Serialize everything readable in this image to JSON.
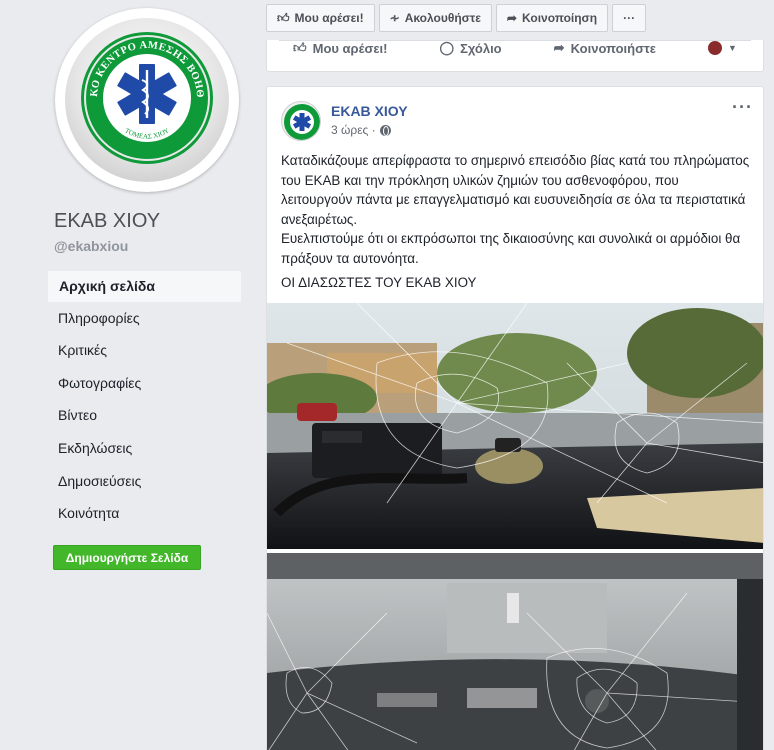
{
  "page": {
    "name": "ΕΚΑΒ ΧΙΟΥ",
    "handle": "@ekabxiou",
    "logo": {
      "ring_text_top": "ΕΘΝΙΚΟ ΚΕΝΤΡΟ ΑΜΕΣΗΣ ΒΟΗΘΕΙΑΣ",
      "ring_text_bottom": "ΤΟΜΕΑΣ ΧΙΟΥ",
      "colors": {
        "ring": "#0f9a3a",
        "star": "#1f4aa8",
        "text": "#ffffff"
      }
    }
  },
  "nav": {
    "items": [
      {
        "label": "Αρχική σελίδα",
        "active": true
      },
      {
        "label": "Πληροφορίες"
      },
      {
        "label": "Κριτικές"
      },
      {
        "label": "Φωτογραφίες"
      },
      {
        "label": "Βίντεο"
      },
      {
        "label": "Εκδηλώσεις"
      },
      {
        "label": "Δημοσιεύσεις"
      },
      {
        "label": "Κοινότητα"
      }
    ],
    "create_page_label": "Δημιουργήστε Σελίδα"
  },
  "actionbar": {
    "like": "Μου αρέσει!",
    "follow": "Ακολουθήστε",
    "share": "Κοινοποίηση",
    "more": "···"
  },
  "prev_post_actions": {
    "like": "Μου αρέσει!",
    "comment": "Σχόλιο",
    "share": "Κοινοποιήστε"
  },
  "post": {
    "author": "ΕΚΑΒ ΧΙΟΥ",
    "time": "3 ώρες ·",
    "more": "···",
    "paragraph1": "Καταδικάζουμε απερίφραστα το σημερινό επεισόδιο βίας κατά του πληρώματος του ΕΚΑΒ και την πρόκληση υλικών ζημιών του ασθενοφόρου, που λειτουργούν πάντα με επαγγελματισμό και ευσυνειδησία σε όλα τα περιστατικά ανεξαιρέτως.",
    "paragraph2": "Ευελπιστούμε ότι οι εκπρόσωποι της δικαιοσύνης και συνολικά οι αρμόδιοι θα πράξουν τα αυτονόητα.",
    "signature": "ΟΙ ΔΙΑΣΩΣΤΕΣ ΤΟΥ ΕΚΑΒ ΧΙΟΥ"
  },
  "colors": {
    "link": "#385898",
    "create_button": "#42b72a",
    "background": "#e9ebee"
  }
}
